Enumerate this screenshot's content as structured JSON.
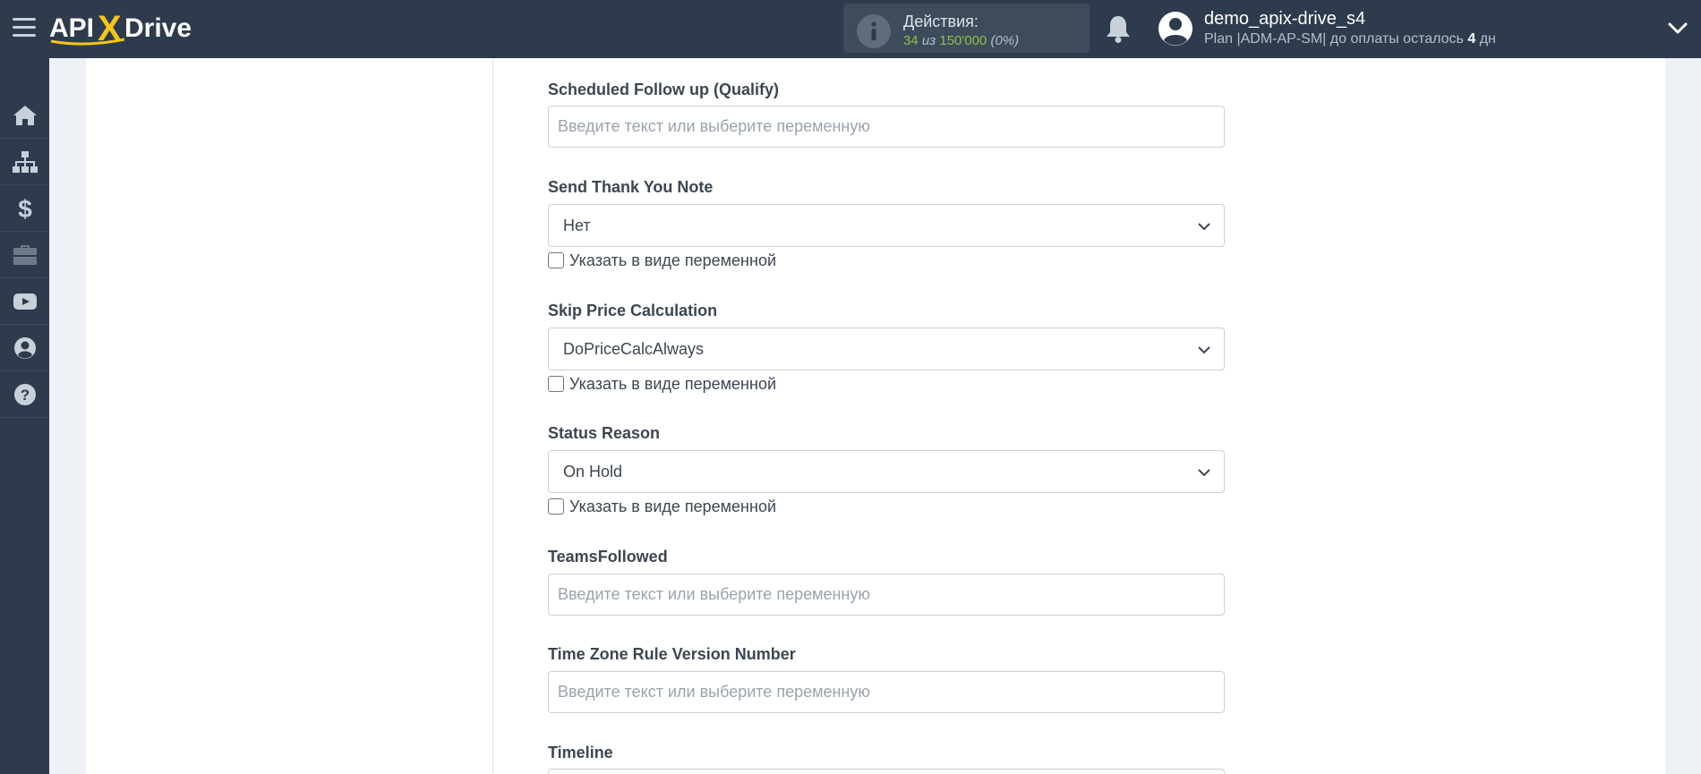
{
  "header": {
    "logo": {
      "prefix": "API",
      "x": "X",
      "suffix": "Drive"
    },
    "actions": {
      "title": "Действия:",
      "used": "34",
      "of": "из",
      "total": "150'000",
      "percent": "(0%)"
    },
    "user": {
      "name": "demo_apix-drive_s4",
      "plan_text": "Plan |ADM-AP-SM| до оплаты осталось",
      "days": "4",
      "days_unit": "дн"
    }
  },
  "sidebar": {
    "items": [
      {
        "name": "home",
        "icon": "home-icon"
      },
      {
        "name": "connections",
        "icon": "sitemap-icon"
      },
      {
        "name": "billing",
        "icon": "dollar-icon"
      },
      {
        "name": "projects",
        "icon": "briefcase-icon"
      },
      {
        "name": "video",
        "icon": "youtube-icon"
      },
      {
        "name": "account",
        "icon": "user-circle-icon"
      },
      {
        "name": "help",
        "icon": "question-circle-icon"
      }
    ]
  },
  "form": {
    "placeholder": "Введите текст или выберите переменную",
    "variable_label": "Указать в виде переменной",
    "fields": {
      "scheduled_follow_up": {
        "label": "Scheduled Follow up (Qualify)"
      },
      "send_thank_you": {
        "label": "Send Thank You Note",
        "value": "Нет"
      },
      "skip_price": {
        "label": "Skip Price Calculation",
        "value": "DoPriceCalcAlways"
      },
      "status_reason": {
        "label": "Status Reason",
        "value": "On Hold"
      },
      "teams_followed": {
        "label": "TeamsFollowed"
      },
      "time_zone_rule": {
        "label": "Time Zone Rule Version Number"
      },
      "timeline": {
        "label": "Timeline"
      }
    }
  },
  "colors": {
    "topbar": "#2d3b4c",
    "accent_green": "#8bc34a",
    "logo_x": "#f5c518"
  }
}
